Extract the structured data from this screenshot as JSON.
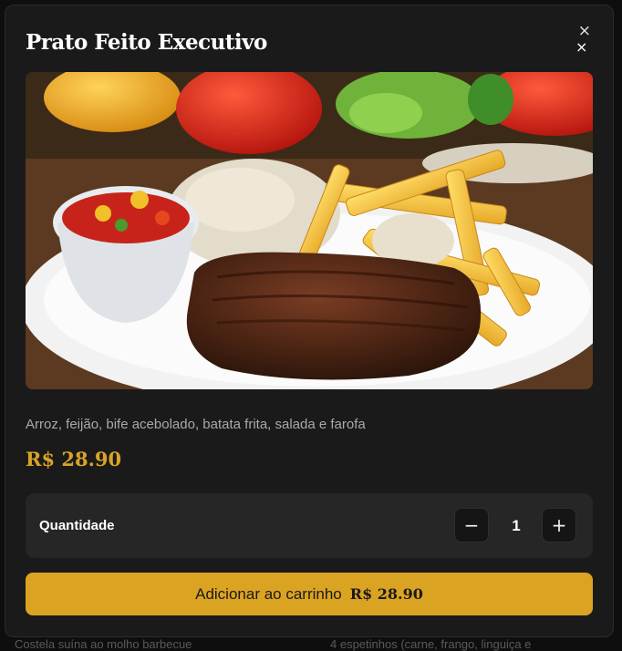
{
  "backdrop": {
    "left_snippet": "Costela suína ao molho barbecue",
    "right_snippet": "4 espetinhos (carne, frango, linguiça e"
  },
  "modal": {
    "title": "Prato Feito Executivo",
    "close_symbol": "×",
    "outer_close_symbol": "×",
    "image_icon": "dish-photo",
    "description": "Arroz, feijão, bife acebolado, batata frita, salada e farofa",
    "price": "R$ 28.90"
  },
  "quantity": {
    "label": "Quantidade",
    "value": "1",
    "decrement_symbol": "−",
    "increment_symbol": "+"
  },
  "cart_button": {
    "label": "Adicionar ao carrinho",
    "price": "R$ 28.90"
  },
  "colors": {
    "accent": "#dba322",
    "price_text": "#d9a326",
    "modal_bg": "#1a1a1a",
    "panel_bg": "#262626"
  }
}
